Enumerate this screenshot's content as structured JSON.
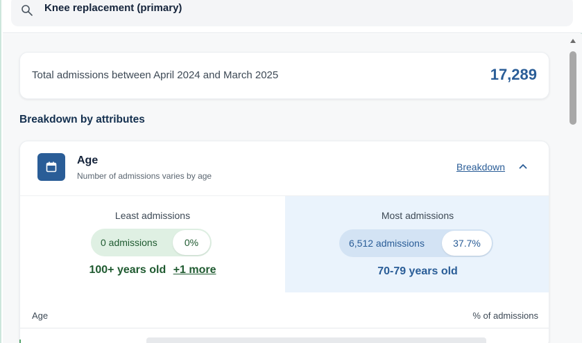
{
  "search": {
    "value": "Knee replacement (primary)",
    "icon": "search-icon"
  },
  "summary": {
    "label": "Total admissions between April 2024 and March 2025",
    "value": "17,289"
  },
  "section": {
    "title": "Breakdown by attributes"
  },
  "attribute": {
    "icon": "calendar-icon",
    "title": "Age",
    "subtitle": "Number of admissions varies by age",
    "breakdown_label": "Breakdown",
    "least": {
      "heading": "Least admissions",
      "count": "0 admissions",
      "percent": "0%",
      "group": "100+ years old",
      "more": "+1 more"
    },
    "most": {
      "heading": "Most admissions",
      "count": "6,512 admissions",
      "percent": "37.7%",
      "group": "70-79 years old"
    },
    "table": {
      "col_left": "Age",
      "col_right": "% of admissions"
    }
  },
  "colors": {
    "accent": "#2a5d97",
    "green": "#1f5a30",
    "most_bg": "#eaf3fc",
    "least_pill": "#dff0e3"
  }
}
